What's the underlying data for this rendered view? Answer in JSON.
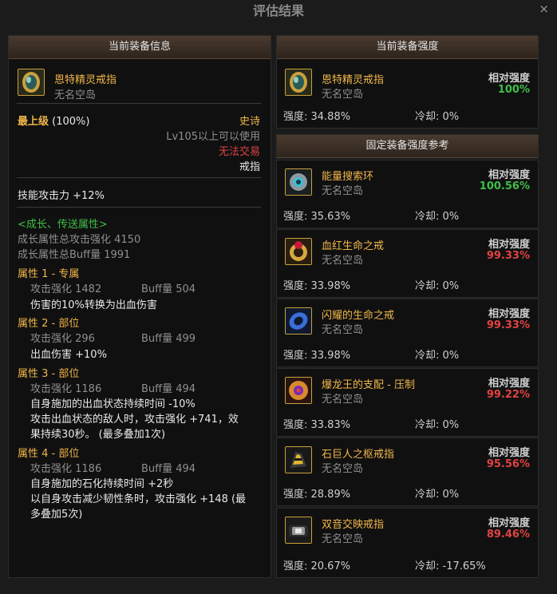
{
  "window": {
    "title": "评估结果",
    "close_symbol": "×"
  },
  "left_panel": {
    "header": "当前装备信息",
    "item": {
      "name": "恩特精灵戒指",
      "source": "无名空岛",
      "icon": "elven-ring-icon"
    },
    "grade": "最上级",
    "grade_pct": "(100%)",
    "rarity": "史诗",
    "level_req": "Lv105以上可以使用",
    "trade": "无法交易",
    "slot": "戒指",
    "skill_attack": "技能攻击力  +12%",
    "growth_title": "<成长、传送属性>",
    "growth_attack": "成长属性总攻击强化 4150",
    "growth_buff": "成长属性总Buff量 1991",
    "attributes": [
      {
        "title": "属性 1 - 专属",
        "attack": "攻击强化   1482",
        "buff": "Buff量   504",
        "desc": [
          "伤害的10%转换为出血伤害"
        ]
      },
      {
        "title": "属性 2 - 部位",
        "attack": "攻击强化   296",
        "buff": "Buff量   499",
        "desc": [
          "出血伤害 +10%"
        ]
      },
      {
        "title": "属性 3 - 部位",
        "attack": "攻击强化   1186",
        "buff": "Buff量   494",
        "desc": [
          "自身施加的出血状态持续时间 -10%",
          "攻击出血状态的敌人时，攻击强化 +741，效",
          "果持续30秒。 (最多叠加1次)"
        ]
      },
      {
        "title": "属性 4 - 部位",
        "attack": "攻击强化   1186",
        "buff": "Buff量   494",
        "desc": [
          "自身施加的石化持续时间 +2秒",
          "以自身攻击减少韧性条时，攻击强化 +148 (最",
          "多叠加5次)"
        ]
      }
    ]
  },
  "current_strength": {
    "header": "当前装备强度",
    "name": "恩特精灵戒指",
    "source": "无名空岛",
    "icon": "elven-ring-icon",
    "rel_label": "相对强度",
    "rel_value": "100%",
    "strength": "强度: 34.88%",
    "cooldown": "冷却: 0%"
  },
  "reference": {
    "header": "固定装备强度参考",
    "items": [
      {
        "name": "能量搜索环",
        "source": "无名空岛",
        "icon": "energy-ring-icon",
        "rel_label": "相对强度",
        "rel_value": "100.56%",
        "rel_color": "#3fbf47",
        "strength": "强度: 35.63%",
        "cooldown": "冷却: 0%"
      },
      {
        "name": "血红生命之戒",
        "source": "无名空岛",
        "icon": "crimson-ring-icon",
        "rel_label": "相对强度",
        "rel_value": "99.33%",
        "rel_color": "#e04343",
        "strength": "强度: 33.98%",
        "cooldown": "冷却: 0%"
      },
      {
        "name": "闪耀的生命之戒",
        "source": "无名空岛",
        "icon": "shining-ring-icon",
        "rel_label": "相对强度",
        "rel_value": "99.33%",
        "rel_color": "#e04343",
        "strength": "强度: 33.98%",
        "cooldown": "冷却: 0%"
      },
      {
        "name": "爆龙王的支配 - 压制",
        "source": "无名空岛",
        "icon": "dragon-ring-icon",
        "rel_label": "相对强度",
        "rel_value": "99.22%",
        "rel_color": "#e04343",
        "strength": "强度: 33.83%",
        "cooldown": "冷却: 0%"
      },
      {
        "name": "石巨人之枢戒指",
        "source": "无名空岛",
        "icon": "golem-ring-icon",
        "rel_label": "相对强度",
        "rel_value": "95.56%",
        "rel_color": "#e04343",
        "strength": "强度: 28.89%",
        "cooldown": "冷却: 0%"
      },
      {
        "name": "双音交映戒指",
        "source": "无名空岛",
        "icon": "dual-tone-ring-icon",
        "rel_label": "相对强度",
        "rel_value": "89.46%",
        "rel_color": "#e04343",
        "strength": "强度: 20.67%",
        "cooldown": "冷却: -17.65%"
      }
    ]
  },
  "colors": {
    "gold": "#f0b64a",
    "green": "#3fbf47",
    "red": "#e04343",
    "panel_bg": "#101010",
    "header_bg": "#3d3026"
  }
}
